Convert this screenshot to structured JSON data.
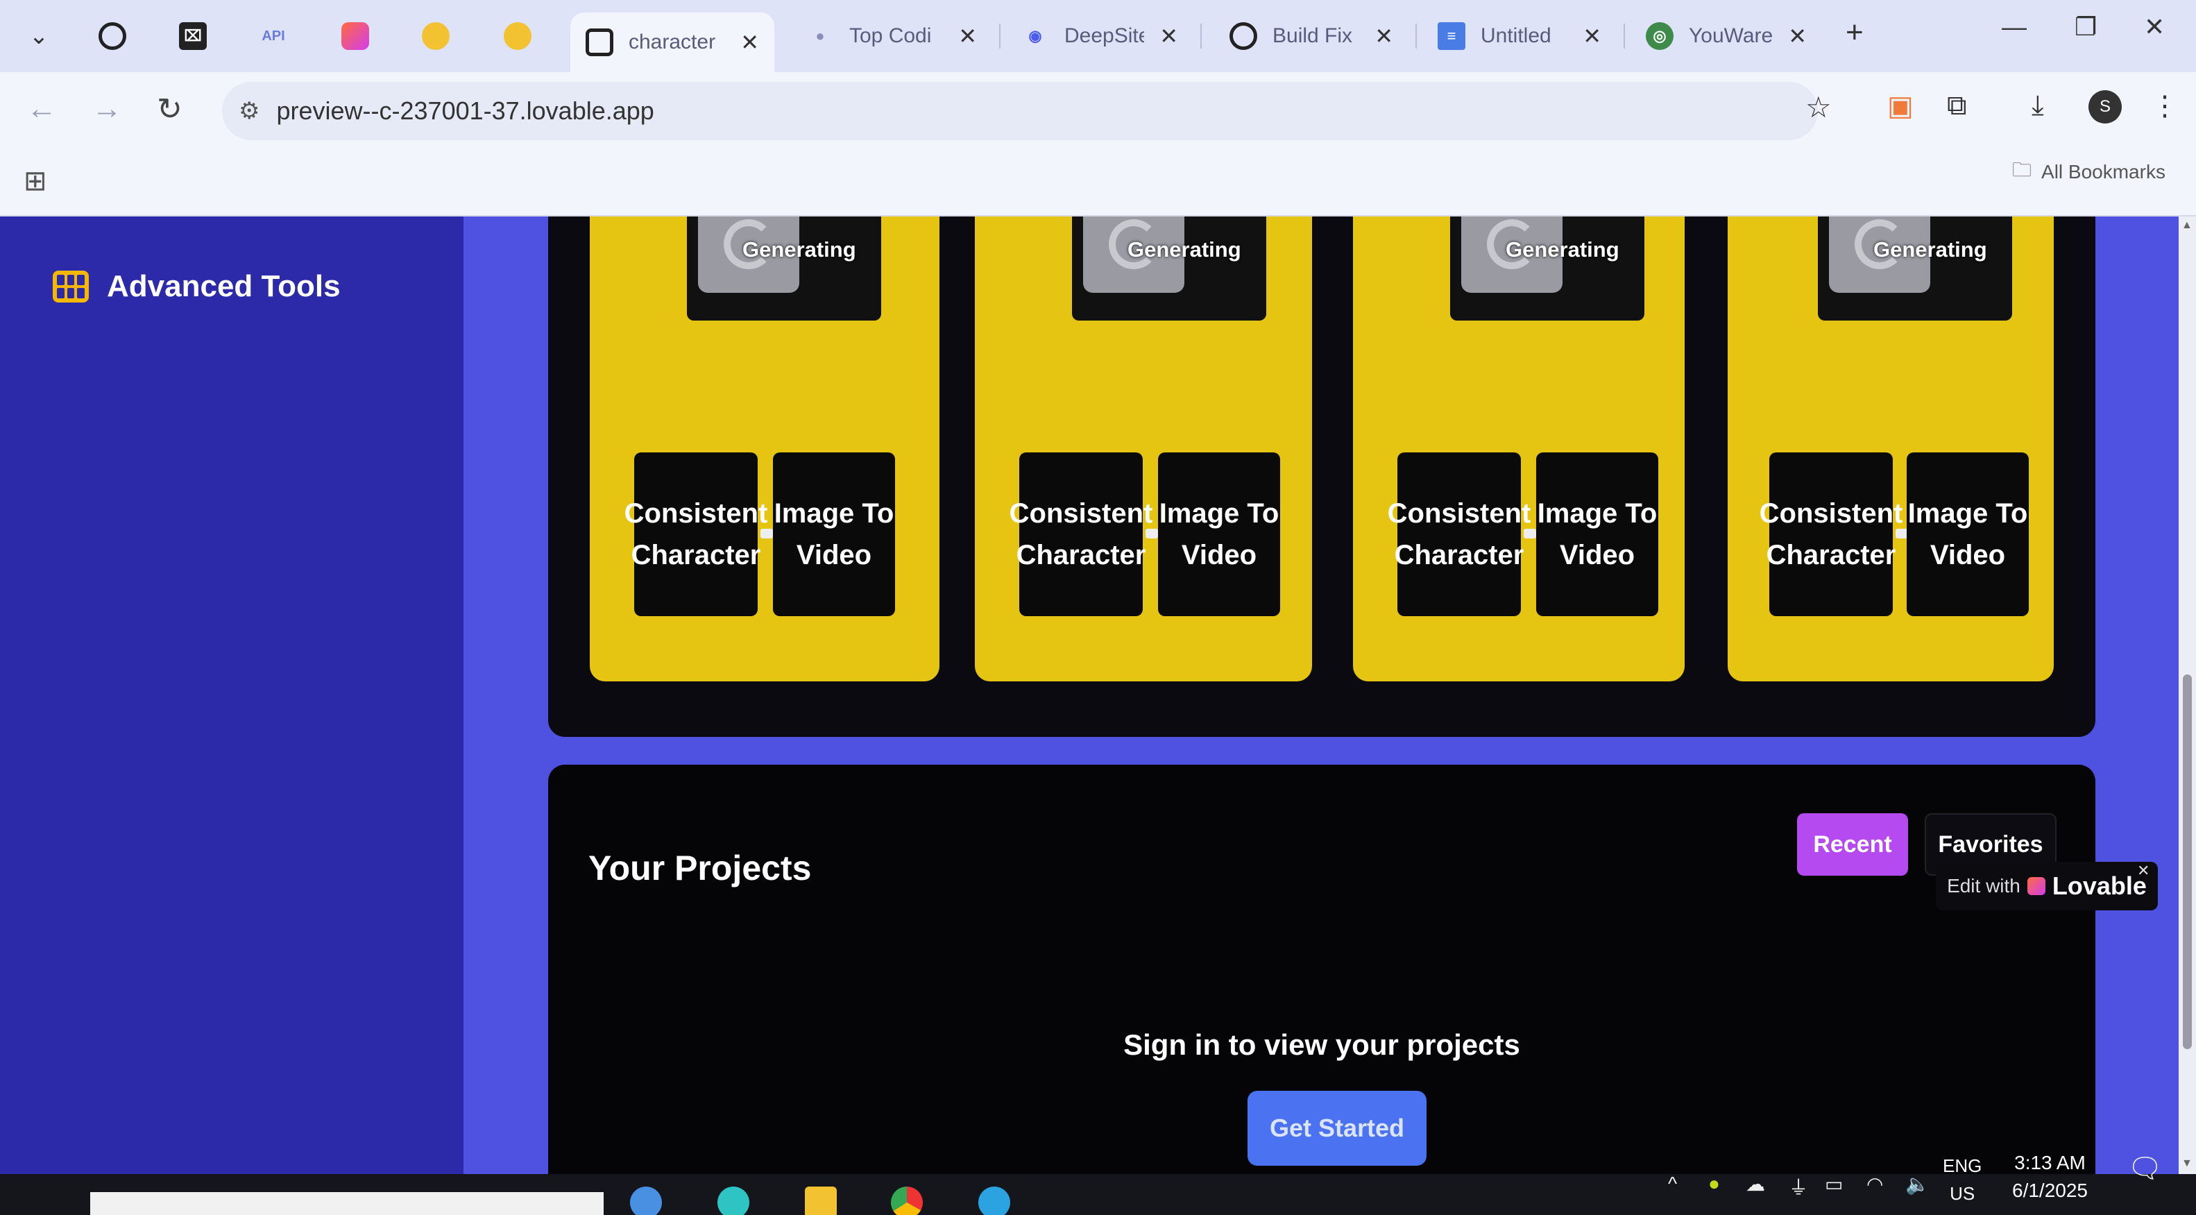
{
  "browser": {
    "tabs": [
      {
        "title": "",
        "icon": "chatgpt-icon"
      },
      {
        "title": "",
        "icon": "replit-icon"
      },
      {
        "title": "API",
        "icon": "api-icon"
      },
      {
        "title": "",
        "icon": "lovable-icon"
      },
      {
        "title": "",
        "icon": "huggingface-icon"
      },
      {
        "title": "",
        "icon": "huggingface-icon"
      },
      {
        "title": "character",
        "icon": "character-icon",
        "active": true
      },
      {
        "title": "Top Codi",
        "icon": "dot-icon"
      },
      {
        "title": "DeepSite",
        "icon": "deepsite-icon"
      },
      {
        "title": "Build Fix",
        "icon": "chatgpt-icon"
      },
      {
        "title": "Untitled",
        "icon": "docs-icon"
      },
      {
        "title": "YouWare",
        "icon": "youware-icon"
      }
    ],
    "new_tab": "+",
    "close_glyph": "✕",
    "url": "preview--c-237001-37.lovable.app",
    "all_bookmarks": "All Bookmarks",
    "profile_initial": "S"
  },
  "sidebar": {
    "advanced_tools_label": "Advanced Tools"
  },
  "tools": {
    "cards": [
      {
        "status": "Generating",
        "option_a": "Consistent Character",
        "option_b": "Image To Video"
      },
      {
        "status": "Generating",
        "option_a": "Consistent Character",
        "option_b": "Image To Video"
      },
      {
        "status": "Generating",
        "option_a": "Consistent Character",
        "option_b": "Image To Video"
      },
      {
        "status": "Generating",
        "option_a": "Consistent Character",
        "option_b": "Image To Video"
      }
    ]
  },
  "projects": {
    "title": "Your Projects",
    "recent_label": "Recent",
    "favorites_label": "Favorites",
    "signin_text": "Sign in to view your projects",
    "get_started_label": "Get Started"
  },
  "lovable_badge": {
    "edit_with": "Edit with",
    "brand": "Lovable"
  },
  "taskbar": {
    "lang": "ENG",
    "region": "US",
    "time": "3:13 AM",
    "date": "6/1/2025"
  },
  "colors": {
    "sidebar": "#2c2aa8",
    "page_bg": "#4f52e0",
    "card_yellow": "#e6c412",
    "recent_purple": "#b44af0",
    "get_started_blue": "#4b72f0"
  }
}
